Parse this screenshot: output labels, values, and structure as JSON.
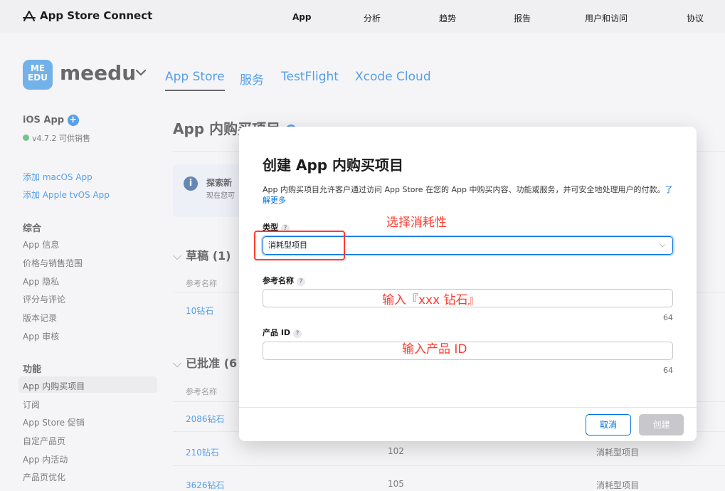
{
  "header": {
    "logo": "App Store Connect",
    "nav": [
      "App",
      "分析",
      "趋势",
      "报告",
      "用户和访问",
      "协议"
    ]
  },
  "app": {
    "icon_text_top": "ME",
    "icon_text_bottom": "EDU",
    "name": "meedu",
    "tabs": [
      "App Store",
      "服务",
      "TestFlight",
      "Xcode Cloud"
    ]
  },
  "sidebar": {
    "platform": "iOS App",
    "version": "v4.7.2 可供销售",
    "add_links": [
      "添加 macOS App",
      "添加 Apple tvOS App"
    ],
    "general_heading": "综合",
    "general_items": [
      "App 信息",
      "价格与销售范围",
      "App 隐私",
      "评分与评论",
      "版本记录",
      "App 审核"
    ],
    "features_heading": "功能",
    "features_items": [
      "App 内购买项目",
      "订阅",
      "App Store 促销",
      "自定产品页",
      "App 内活动",
      "产品页优化"
    ]
  },
  "main": {
    "title": "App 内购买项目",
    "info_title": "探索新",
    "info_text": "现在您可",
    "draft_heading": "草稿 (1)",
    "approved_heading": "已批准 (6",
    "col_ref_name": "参考名称",
    "draft_rows": [
      "10钻石"
    ],
    "approved_rows": [
      {
        "name": "2086钻石",
        "id": "",
        "type": ""
      },
      {
        "name": "210钻石",
        "id": "102",
        "type": "消耗型项目"
      },
      {
        "name": "3626钻石",
        "id": "105",
        "type": "消耗型项目"
      }
    ]
  },
  "modal": {
    "title": "创建 App 内购买项目",
    "description": "App 内购买项目允许客户通过访问 App Store 在您的 App 中购买内容、功能或服务，并可安全地处理用户的付款。",
    "learn_more": "了解更多",
    "type_label": "类型",
    "type_value": "消耗型项目",
    "ref_label": "参考名称",
    "ref_counter": "64",
    "product_id_label": "产品 ID",
    "product_id_counter": "64",
    "cancel": "取消",
    "create": "创建"
  },
  "annotations": {
    "type_note": "选择消耗性",
    "ref_note": "输入『xxx 钻石』",
    "id_note": "输入产品 ID"
  },
  "colors": {
    "accent": "#0071e3",
    "annotation": "#ff3b30"
  }
}
